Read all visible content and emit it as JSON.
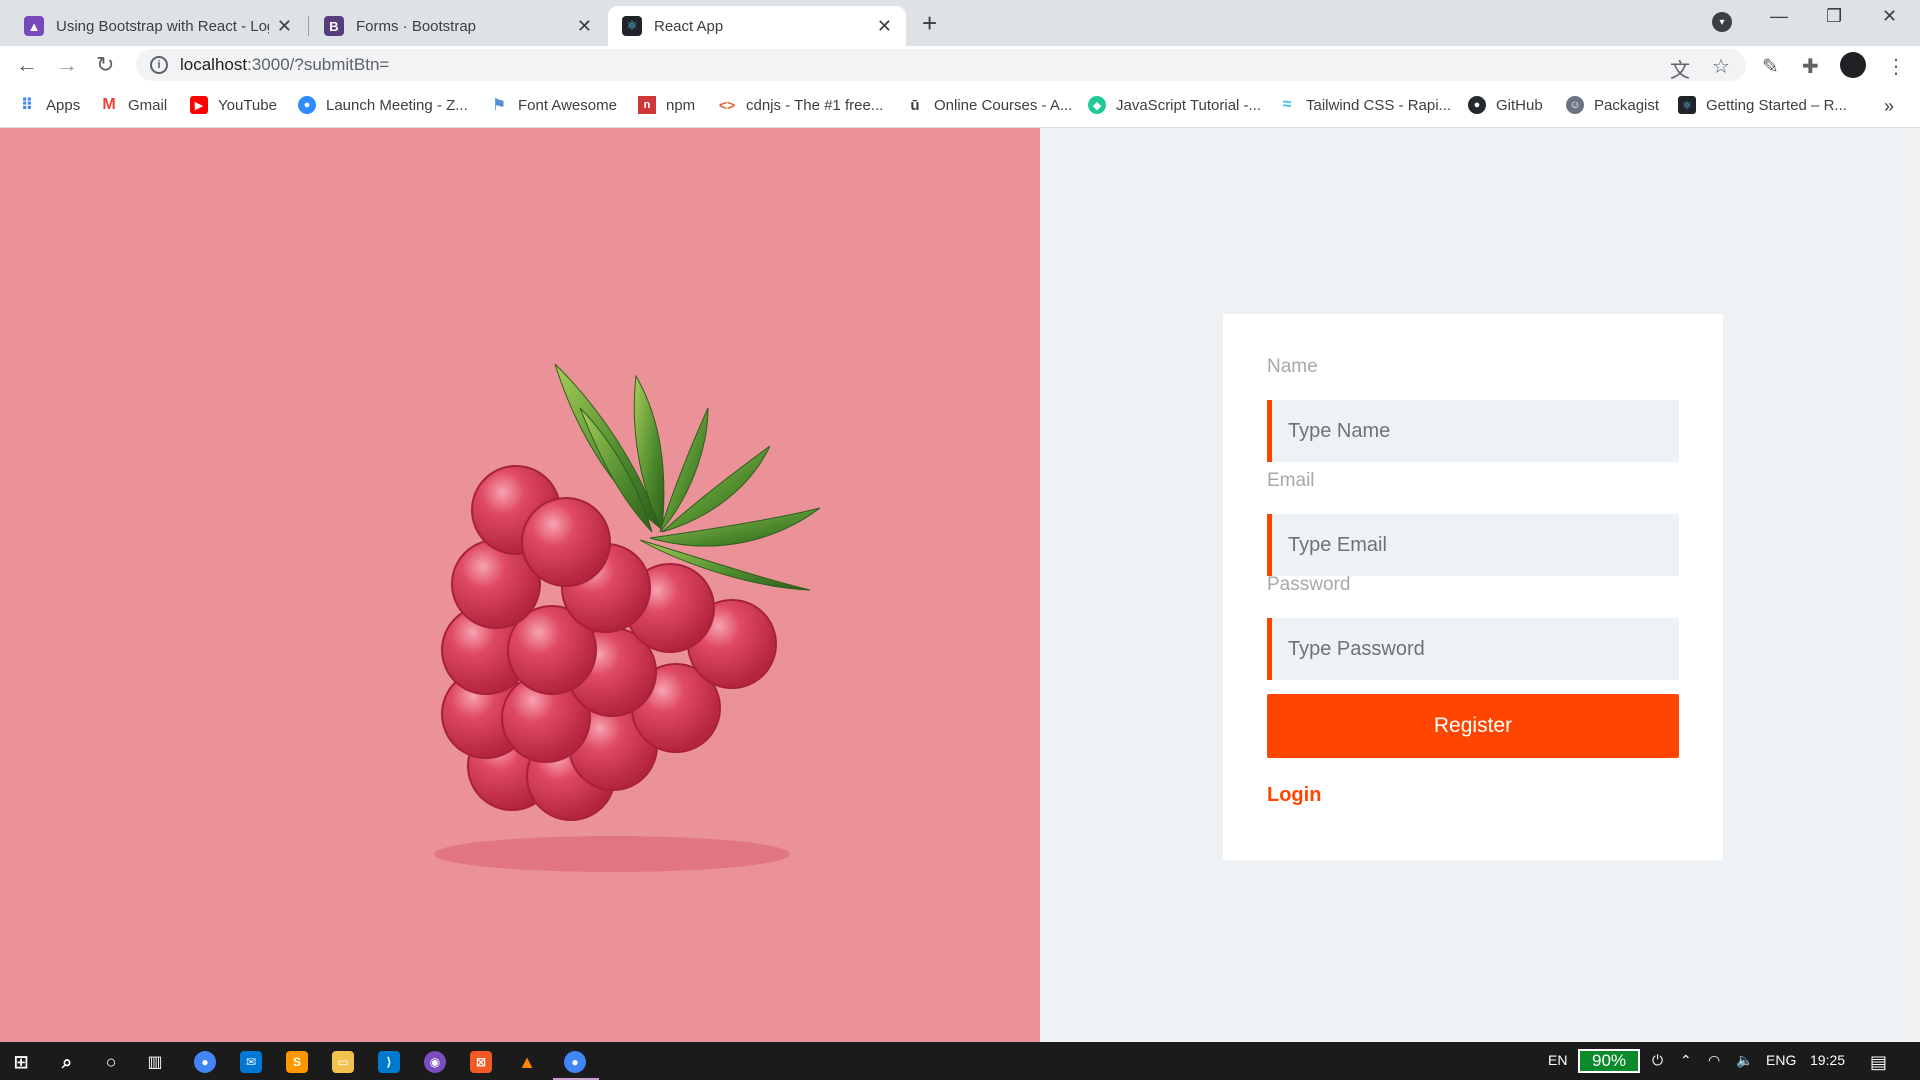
{
  "browser": {
    "tabs": [
      {
        "title": "Using Bootstrap with React - Log",
        "icon": "logrocket-icon",
        "color": "#764abc"
      },
      {
        "title": "Forms · Bootstrap",
        "icon": "bootstrap-icon",
        "color": "#563d7c"
      },
      {
        "title": "React App",
        "icon": "react-icon",
        "color": "#20232a",
        "active": true
      }
    ],
    "url_host": "localhost",
    "url_path": ":3000/?submitBtn="
  },
  "bookmarks": [
    {
      "label": "Apps",
      "icon": "apps-grid-icon",
      "color": "#4285f4"
    },
    {
      "label": "Gmail",
      "icon": "gmail-icon",
      "color": "#ea4335"
    },
    {
      "label": "YouTube",
      "icon": "youtube-icon",
      "color": "#ff0000"
    },
    {
      "label": "Launch Meeting - Z...",
      "icon": "zoom-icon",
      "color": "#2d8cff"
    },
    {
      "label": "Font Awesome",
      "icon": "flag-icon",
      "color": "#528dd7"
    },
    {
      "label": "npm",
      "icon": "npm-icon",
      "color": "#cb3837"
    },
    {
      "label": "cdnjs - The #1 free...",
      "icon": "code-icon",
      "color": "#d9643a"
    },
    {
      "label": "Online Courses - A...",
      "icon": "udemy-icon",
      "color": "#a435f0"
    },
    {
      "label": "JavaScript Tutorial -...",
      "icon": "js-icon",
      "color": "#20c997"
    },
    {
      "label": "Tailwind CSS - Rapi...",
      "icon": "tailwind-icon",
      "color": "#38bdf8"
    },
    {
      "label": "GitHub",
      "icon": "github-icon",
      "color": "#24292e"
    },
    {
      "label": "Packagist",
      "icon": "packagist-icon",
      "color": "#6b7280"
    },
    {
      "label": "Getting Started – R...",
      "icon": "react-icon",
      "color": "#20232a"
    }
  ],
  "form": {
    "name_label": "Name",
    "name_placeholder": "Type Name",
    "email_label": "Email",
    "email_placeholder": "Type Email",
    "password_label": "Password",
    "password_placeholder": "Type Password",
    "register_label": "Register",
    "login_label": "Login"
  },
  "colors": {
    "accent": "#ff4500",
    "left_bg": "#ea9297",
    "right_bg": "#eef2f5"
  },
  "taskbar": {
    "lang_short": "EN",
    "battery": "90%",
    "lang": "ENG",
    "time": "19:25"
  }
}
